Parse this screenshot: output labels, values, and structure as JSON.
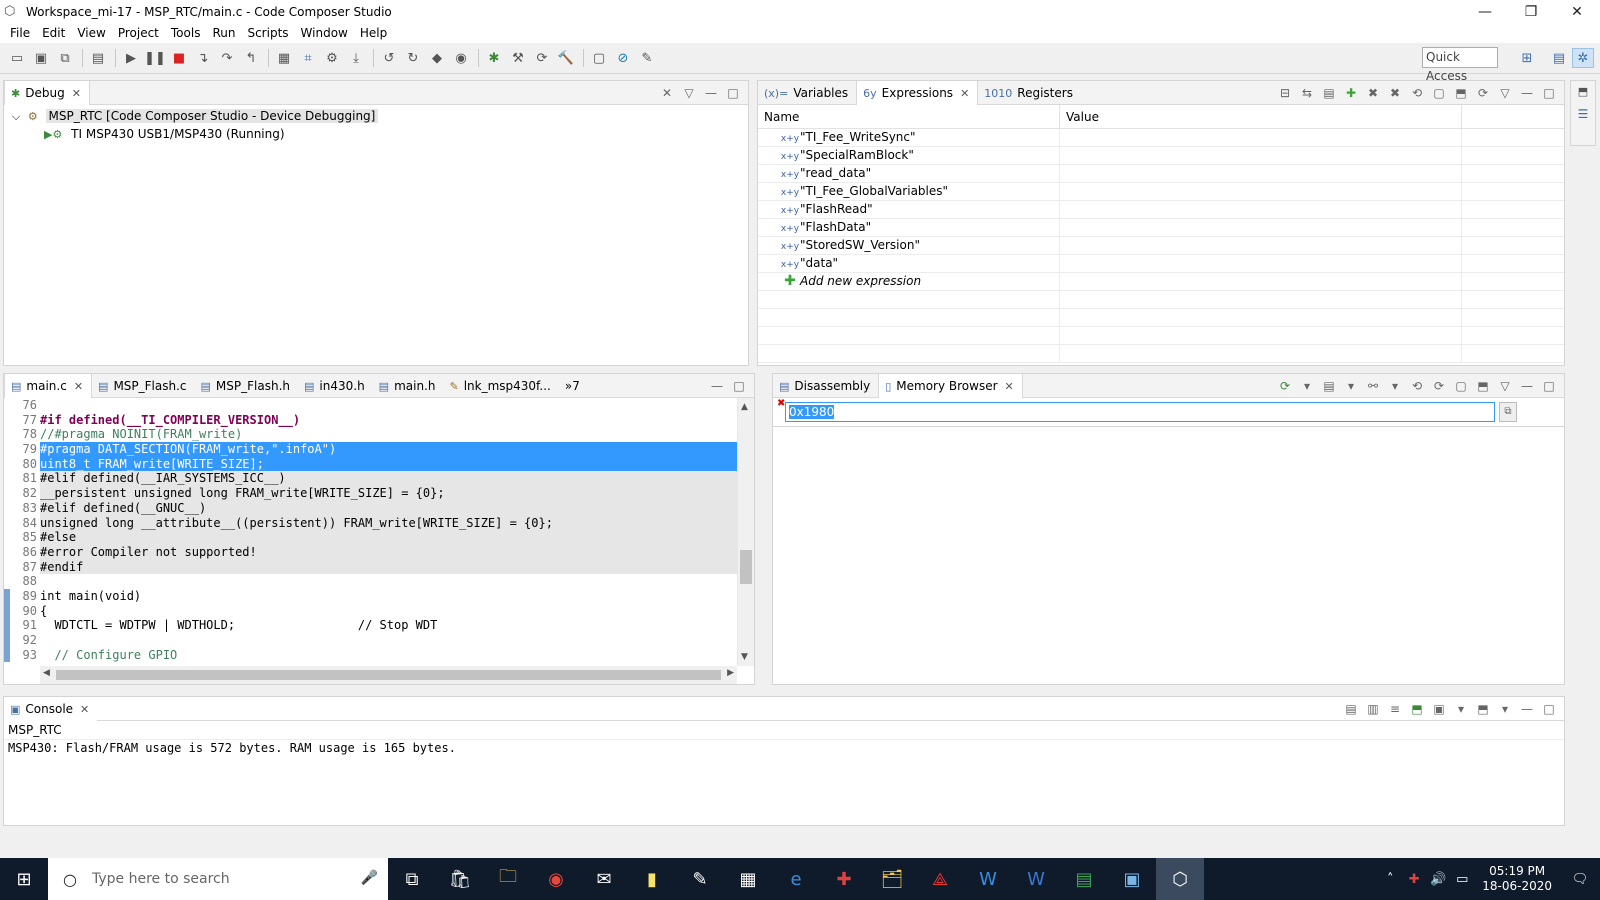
{
  "window": {
    "title": "Workspace_mi-17 - MSP_RTC/main.c - Code Composer Studio",
    "minimize": "—",
    "maximize": "❐",
    "close": "✕"
  },
  "menu": [
    "File",
    "Edit",
    "View",
    "Project",
    "Tools",
    "Run",
    "Scripts",
    "Window",
    "Help"
  ],
  "toolbar": {
    "quick_access": "Quick Access"
  },
  "debug": {
    "tab_label": "Debug",
    "tree": [
      {
        "label": "MSP_RTC [Code Composer Studio - Device Debugging]",
        "expander": "⌵"
      },
      {
        "label": "TI MSP430 USB1/MSP430 (Running)"
      }
    ]
  },
  "vars": {
    "tabs": [
      {
        "label": "Variables",
        "icon": "(x)="
      },
      {
        "label": "Expressions",
        "icon": "6y"
      },
      {
        "label": "Registers",
        "icon": "1010"
      }
    ],
    "columns": [
      "Name",
      "Value"
    ],
    "expressions": [
      "\"TI_Fee_WriteSync\"",
      "\"SpecialRamBlock\"",
      "\"read_data\"",
      "\"TI_Fee_GlobalVariables\"",
      "\"FlashRead\"",
      "\"FlashData\"",
      "\"StoredSW_Version\"",
      "\"data\""
    ],
    "add_new": "Add new expression"
  },
  "editor": {
    "tabs": [
      "main.c",
      "MSP_Flash.c",
      "MSP_Flash.h",
      "in430.h",
      "main.h",
      "lnk_msp430f..."
    ],
    "overflow": "»7",
    "lines": [
      {
        "n": "76",
        "t": ""
      },
      {
        "n": "77",
        "t": "#if defined(__TI_COMPILER_VERSION__)"
      },
      {
        "n": "78",
        "t": "//#pragma NOINIT(FRAM_write)"
      },
      {
        "n": "79",
        "t": "#pragma DATA_SECTION(FRAM_write,\".infoA\")"
      },
      {
        "n": "80",
        "t": "uint8_t FRAM_write[WRITE_SIZE];"
      },
      {
        "n": "81",
        "t": "#elif defined(__IAR_SYSTEMS_ICC__)"
      },
      {
        "n": "82",
        "t": "__persistent unsigned long FRAM_write[WRITE_SIZE] = {0};"
      },
      {
        "n": "83",
        "t": "#elif defined(__GNUC__)"
      },
      {
        "n": "84",
        "t": "unsigned long __attribute__((persistent)) FRAM_write[WRITE_SIZE] = {0};"
      },
      {
        "n": "85",
        "t": "#else"
      },
      {
        "n": "86",
        "t": "#error Compiler not supported!"
      },
      {
        "n": "87",
        "t": "#endif"
      },
      {
        "n": "88",
        "t": ""
      },
      {
        "n": "89",
        "t": "int main(void)"
      },
      {
        "n": "90",
        "t": "{"
      },
      {
        "n": "91",
        "t": "  WDTCTL = WDTPW | WDTHOLD;                 // Stop WDT"
      },
      {
        "n": "92",
        "t": ""
      },
      {
        "n": "93",
        "t": "  // Configure GPIO"
      }
    ]
  },
  "memory": {
    "tabs": [
      "Disassembly",
      "Memory Browser"
    ],
    "address": "0x1980"
  },
  "console": {
    "tab_label": "Console",
    "project": "MSP_RTC",
    "output": "MSP430:  Flash/FRAM usage is 572 bytes. RAM usage is 165 bytes."
  },
  "taskbar": {
    "search_placeholder": "Type here to search",
    "time": "05:19 PM",
    "date": "18-06-2020"
  }
}
